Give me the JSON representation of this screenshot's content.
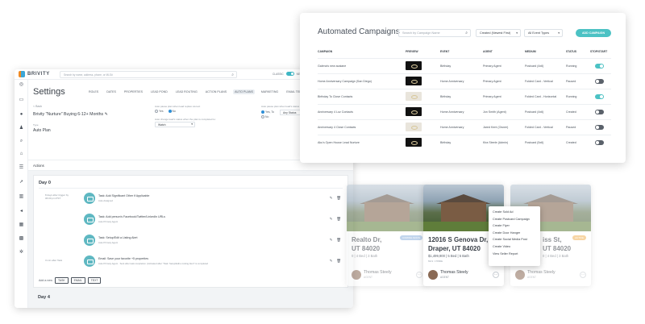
{
  "settings": {
    "logo_text": "BRIVITY",
    "search_placeholder": "Search by name, address, phone, or MLS#",
    "classic_label": "CLASSIC",
    "new_label": "NEW",
    "title": "Settings",
    "tabs": [
      "ROLES",
      "DATES",
      "PROPERTIES",
      "LEAD POND",
      "LEAD ROUTING",
      "ACTION PLANS",
      "AUTO PLANS",
      "MARKETING",
      "EMAIL TEMPLATES"
    ],
    "active_tab": "AUTO PLANS",
    "back_label": "< Back",
    "plan_name": "Brivity \"Nurture\" Buying 6-12+ Months",
    "type_label": "Type",
    "type_value": "Auto Plan",
    "pause_label": "Auto pause plan when lead replies via text",
    "pause_yes": "Yes",
    "pause_no": "No",
    "change_label": "Auto change lead's status when the plan is completed to:",
    "change_value": "Watch",
    "pause_label2": "Auto pause plan when lead's status chan...",
    "pause2_yes": "Yes, To",
    "pause2_no": "No",
    "pause2_select": "Any Status",
    "actions_label": "Actions",
    "day0": "Day 0",
    "day4": "Day 4",
    "trigger_text": "8 days after trigger by 06:00 pm PST",
    "trigger_text2": "3 min after Task",
    "tasks": [
      {
        "name": "Task: Add Significant Other if Applicable",
        "sub": "Auto Assigned"
      },
      {
        "name": "Task: Add person's Facebook/Twitter/LinkedIn URLs",
        "sub": "Auto Primary Agent"
      },
      {
        "name": "Task: Setup/Edit a Listing Alert",
        "sub": "Auto Primary Agent"
      },
      {
        "name": "Email: Save your favorite +5 properties",
        "sub": "Auto Primary Agent · Sent after task completion | Activated after \"Task: Setup/Edit a Listing Alert\" is completed"
      }
    ],
    "add_new_label": "Add a new",
    "add_buttons": [
      "TASK",
      "EMAIL",
      "TEXT"
    ]
  },
  "campaigns": {
    "title": "Automated Campaigns",
    "search_placeholder": "Search by Campaign Name",
    "sort_value": "Created (Newest First)",
    "filter_value": "All Event Types",
    "add_button": "ADD CAMPAIGN",
    "columns": [
      "CAMPAIGN",
      "PREVIEW",
      "EVENT",
      "AGENT",
      "MEDIUM",
      "STATUS",
      "STOP/START"
    ],
    "rows": [
      {
        "campaign": "Galena's new acaiane",
        "event": "Birthday",
        "agent": "Primary Agent",
        "medium": "Postcard (4x6)",
        "status": "Running",
        "on": true
      },
      {
        "campaign": "Home Anniversary Campaign (San Diego)",
        "event": "Home Anniversary",
        "agent": "Primary Agent",
        "medium": "Folded Card - Vertical",
        "status": "Paused",
        "on": false
      },
      {
        "campaign": "Birthday To Close Contacts",
        "event": "Birthday",
        "agent": "Primary Agent",
        "medium": "Folded Card - Horizontal",
        "status": "Running",
        "on": true
      },
      {
        "campaign": "Anniversary 4 Loz Contacts",
        "event": "Home Anniversary",
        "agent": "Jon Smith (Agent)",
        "medium": "Postcard (4x6)",
        "status": "Created",
        "on": false
      },
      {
        "campaign": "Anniversary 4 Close Contacts",
        "event": "Home Anniversary",
        "agent": "Jared Kent (Owner)",
        "medium": "Folded Card - Vertical",
        "status": "Paused",
        "on": false
      },
      {
        "campaign": "Aku's Open House Lead Nurture",
        "event": "Birthday",
        "agent": "Kira Steele (Admin)",
        "medium": "Postcard (5x6)",
        "status": "Created",
        "on": false
      }
    ]
  },
  "properties": [
    {
      "addr1": "Realto Dr,",
      "addr2": "UT 84020",
      "facts": "0 | 4 Bed | 3 Bath",
      "mls": "",
      "agent": "Thomas Steely",
      "role": "AGENT",
      "badge": "COMING SOON"
    },
    {
      "addr1": "12016 S Genova Dr,",
      "addr2": "Draper, UT 84020",
      "facts": "$1,499,900 | 5 Bed | 5 Bath",
      "mls": "MLS: 17890E",
      "agent": "Thomas Steely",
      "role": "AGENT",
      "badge": ""
    },
    {
      "addr1": "iss St,",
      "addr2": "UT 84020",
      "facts": "0 | 4 Bed | 3 Bath",
      "mls": "",
      "agent": "Thomas Steely",
      "role": "AGENT",
      "badge": "ACTIVE"
    }
  ],
  "menu": [
    "Create Sold Ad",
    "Create Postcard Campaign",
    "Create Flyer",
    "Create Door Hanger",
    "Create Social Media Post",
    "Create Video",
    "View Seller Report"
  ],
  "colors": {
    "accent": "#4cc2c4",
    "task_icon": "#5fb8c2",
    "logo_orange": "#f08a24",
    "logo_blue": "#3aa7d9"
  }
}
